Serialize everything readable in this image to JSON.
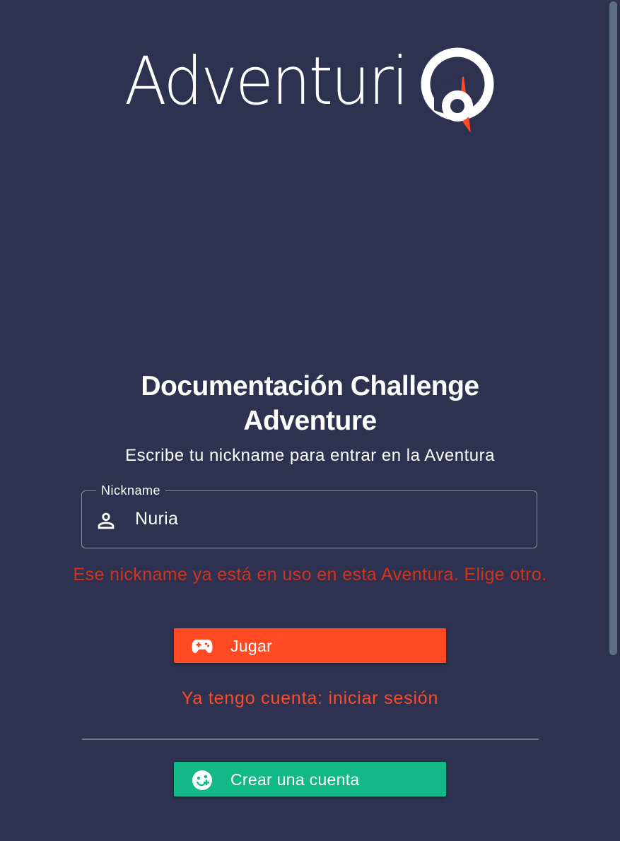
{
  "logo": {
    "text": "Adventuri",
    "accent_color": "#ff4a24"
  },
  "page": {
    "title": "Documentación Challenge Adventure",
    "subtitle": "Escribe tu nickname para entrar en la Aventura"
  },
  "form": {
    "nickname_label": "Nickname",
    "nickname_value": "Nuria",
    "error": "Ese nickname ya está en uso en esta Aventura. Elige otro."
  },
  "actions": {
    "play_label": "Jugar",
    "login_link": "Ya tengo cuenta: iniciar sesión",
    "create_label": "Crear una cuenta"
  },
  "icons": {
    "field": "person-icon",
    "play": "gamepad-icon",
    "create": "face-add-icon"
  },
  "colors": {
    "background": "#2e3250",
    "primary": "#ff4a24",
    "success": "#12b886",
    "error": "#d2321c"
  }
}
